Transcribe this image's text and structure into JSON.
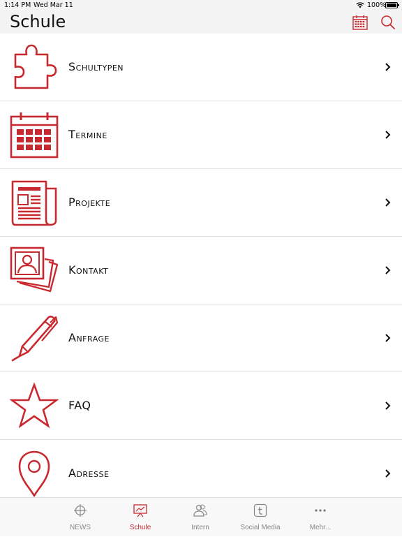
{
  "status_bar": {
    "time": "1:14 PM",
    "date": "Wed Mar 11",
    "battery": "100%"
  },
  "nav": {
    "title": "Schule"
  },
  "accent_color": "#c8292f",
  "items": [
    {
      "label": "Schultypen",
      "icon": "puzzle-icon"
    },
    {
      "label": "Termine",
      "icon": "calendar-icon"
    },
    {
      "label": "Projekte",
      "icon": "newspaper-icon"
    },
    {
      "label": "Kontakt",
      "icon": "photos-contact-icon"
    },
    {
      "label": "Anfrage",
      "icon": "pen-icon"
    },
    {
      "label": "FAQ",
      "icon": "star-icon"
    },
    {
      "label": "Adresse",
      "icon": "map-pin-icon"
    }
  ],
  "tabs": [
    {
      "label": "NEWS",
      "icon": "crosshair-icon"
    },
    {
      "label": "Schule",
      "icon": "presentation-icon",
      "active": true
    },
    {
      "label": "Intern",
      "icon": "users-icon"
    },
    {
      "label": "Social Media",
      "icon": "tumblr-icon"
    },
    {
      "label": "Mehr...",
      "icon": "more-icon"
    }
  ]
}
